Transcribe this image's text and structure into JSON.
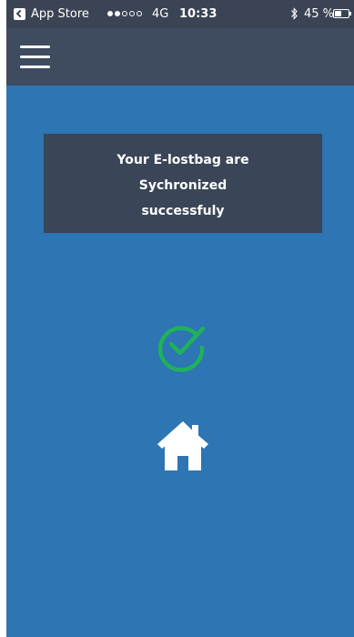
{
  "status_bar": {
    "carrier": "App Store",
    "signal_dots_filled": 2,
    "signal_dots_total": 5,
    "network": "4G",
    "time": "10:33",
    "battery_percent": "45 %",
    "icons": [
      "app-store-back-icon",
      "bluetooth-icon",
      "battery-icon"
    ]
  },
  "navbar": {
    "menu_icon": "hamburger-menu-icon"
  },
  "message": {
    "lines": [
      "Your E-lostbag are",
      "Sychronized",
      "successfuly"
    ]
  },
  "icons": {
    "success": "check-circle-icon",
    "home": "home-icon"
  },
  "colors": {
    "background": "#2d75b3",
    "status_bar": "#3a4454",
    "navbar": "#3f4b5e",
    "message_box": "#3a4658",
    "success_green": "#1fb25a"
  }
}
